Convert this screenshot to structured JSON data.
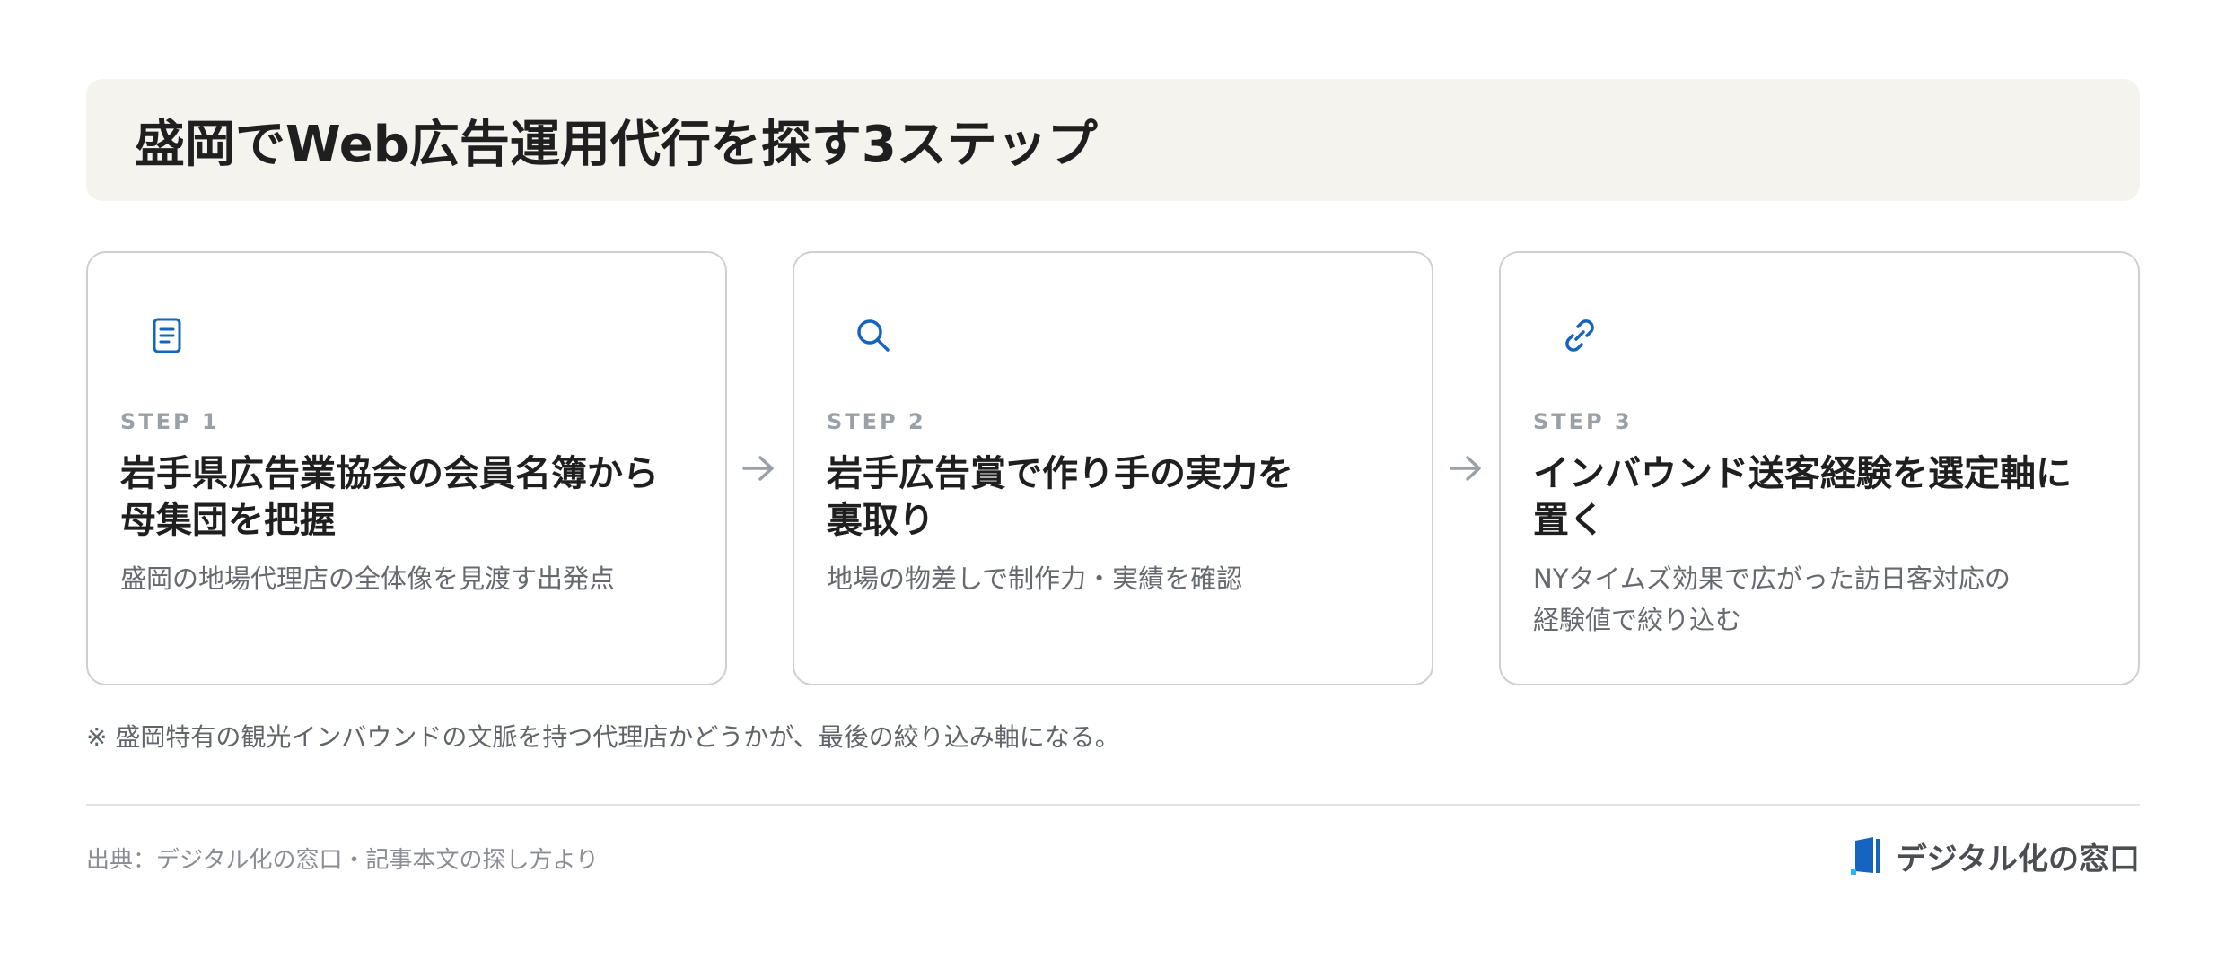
{
  "header": {
    "title": "盛岡でWeb広告運用代行を探す3ステップ"
  },
  "steps": [
    {
      "icon": "document-icon",
      "label": "STEP 1",
      "title_line1": "岩手県広告業協会の会員名簿から",
      "title_line2": "母集団を把握",
      "desc_line1": "盛岡の地場代理店の全体像を見渡す出発点",
      "desc_line2": ""
    },
    {
      "icon": "search-icon",
      "label": "STEP 2",
      "title_line1": "岩手広告賞で作り手の実力を",
      "title_line2": "裏取り",
      "desc_line1": "地場の物差しで制作力・実績を確認",
      "desc_line2": ""
    },
    {
      "icon": "link-icon",
      "label": "STEP 3",
      "title_line1": "インバウンド送客経験を選定軸に",
      "title_line2": "置く",
      "desc_line1": "NYタイムズ効果で広がった訪日客対応の",
      "desc_line2": "経験値で絞り込む"
    }
  ],
  "note": "※ 盛岡特有の観光インバウンドの文脈を持つ代理店かどうかが、最後の絞り込み軸になる。",
  "footer": {
    "source": "出典：デジタル化の窓口・記事本文の探し方より",
    "brand": "デジタル化の窓口"
  },
  "colors": {
    "accent": "#1565c0",
    "header_bg": "#f5f3ee",
    "step_label": "#9aa0a8",
    "arrow": "#9aa0a8"
  }
}
